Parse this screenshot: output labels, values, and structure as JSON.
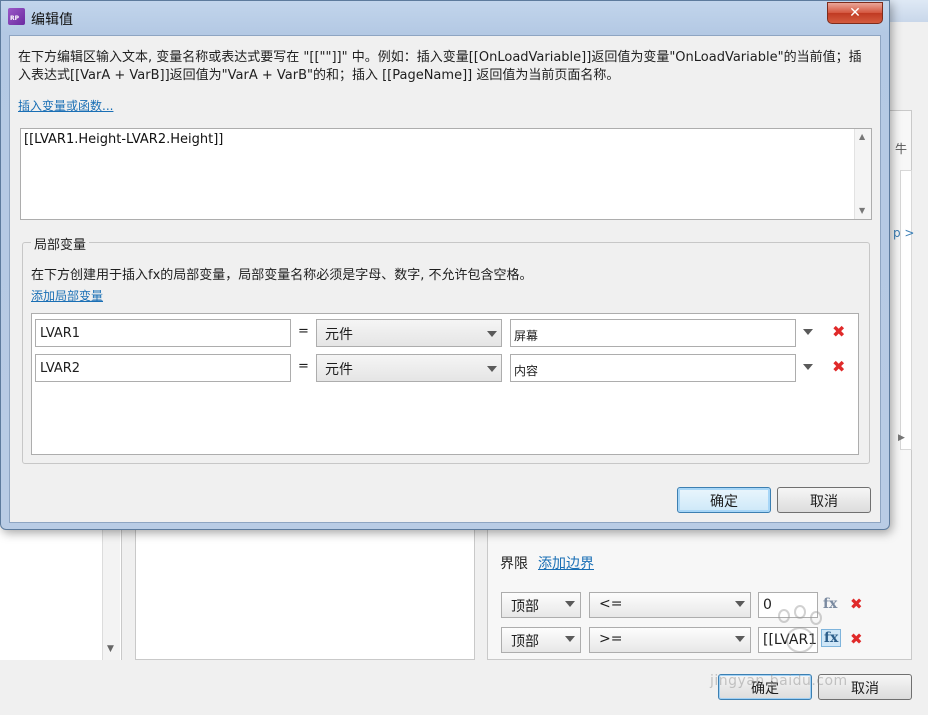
{
  "dialog": {
    "title": "编辑值",
    "app_icon_text": "RP",
    "close_symbol": "✕",
    "description": "在下方编辑区输入文本, 变量名称或表达式要写在 \"[[\"\"]]\" 中。例如：插入变量[[OnLoadVariable]]返回值为变量\"OnLoadVariable\"的当前值；插入表达式[[VarA + VarB]]返回值为\"VarA + VarB\"的和；插入 [[PageName]] 返回值为当前页面名称。",
    "insert_link": "插入变量或函数...",
    "expression": "[[LVAR1.Height-LVAR2.Height]]",
    "scroll_up": "▲",
    "scroll_down": "▼",
    "local_vars": {
      "title": "局部变量",
      "description": "在下方创建用于插入fx的局部变量，局部变量名称必须是字母、数字, 不允许包含空格。",
      "add_link": "添加局部变量",
      "equals": "=",
      "delete_symbol": "✖",
      "rows": [
        {
          "name": "LVAR1",
          "type": "元件",
          "target": "屏幕"
        },
        {
          "name": "LVAR2",
          "type": "元件",
          "target": "内容"
        }
      ]
    },
    "ok_label": "确定",
    "cancel_label": "取消"
  },
  "background": {
    "bounds_label": "界限",
    "add_bounds_link": "添加边界",
    "edge_text_1": "牛",
    "edge_text_2": "p >",
    "edge_arrow": "▶",
    "left_scroll_arrow": "▼",
    "bounds_rows": [
      {
        "side": "顶部",
        "op": "<=",
        "value": "0",
        "fx": "fx",
        "del": "✖"
      },
      {
        "side": "顶部",
        "op": ">=",
        "value": "[[LVAR1",
        "fx": "fx",
        "del": "✖"
      }
    ],
    "ok_label": "确定",
    "cancel_label": "取消"
  },
  "watermark": {
    "text": "jingyan.baidu.com"
  }
}
